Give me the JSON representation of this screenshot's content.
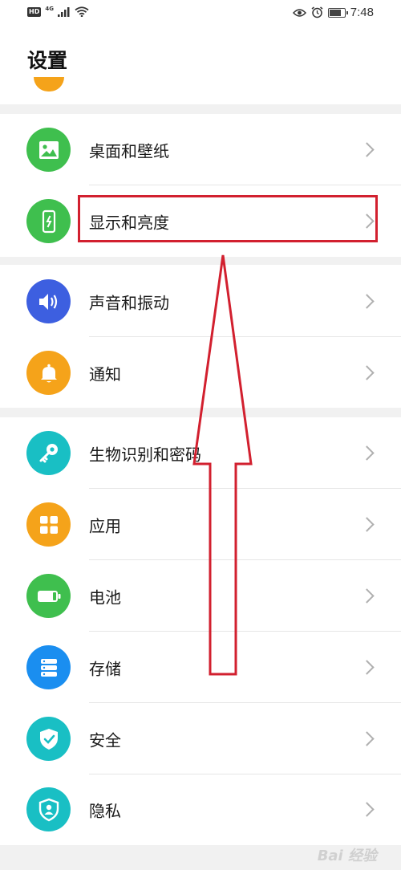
{
  "status_bar": {
    "hd": "HD",
    "network": "4G",
    "time": "7:48"
  },
  "page": {
    "title": "设置"
  },
  "items": [
    {
      "label": "桌面和壁纸",
      "icon": "image-icon",
      "color": "#3fbf4e"
    },
    {
      "label": "显示和亮度",
      "icon": "phone-brightness-icon",
      "color": "#3fbf4e"
    },
    {
      "label": "声音和振动",
      "icon": "speaker-icon",
      "color": "#3d5fe0"
    },
    {
      "label": "通知",
      "icon": "bell-icon",
      "color": "#f5a31a"
    },
    {
      "label": "生物识别和密码",
      "icon": "key-icon",
      "color": "#19bfc4"
    },
    {
      "label": "应用",
      "icon": "apps-grid-icon",
      "color": "#f5a31a"
    },
    {
      "label": "电池",
      "icon": "battery-icon",
      "color": "#3fbf4e"
    },
    {
      "label": "存储",
      "icon": "storage-icon",
      "color": "#1a8ef0"
    },
    {
      "label": "安全",
      "icon": "shield-check-icon",
      "color": "#19bfc4"
    },
    {
      "label": "隐私",
      "icon": "privacy-shield-icon",
      "color": "#19bfc4"
    }
  ],
  "highlight_color": "#d2202f",
  "watermark": "Bai 经验"
}
